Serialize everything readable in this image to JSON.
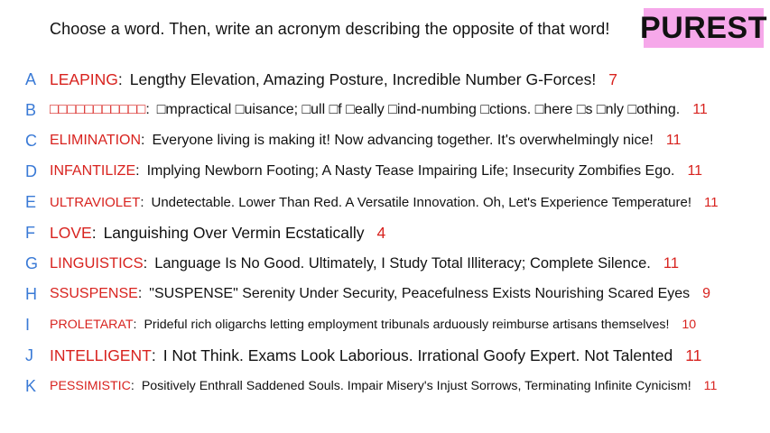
{
  "prompt": "Choose a word. Then, write an acronym describing the opposite of that word!",
  "badge": "PUREST",
  "rows": [
    {
      "letter": "A",
      "word": "LEAPING",
      "acronym": "Lengthy Elevation, Amazing Posture, Incredible Number G-Forces!",
      "count": "7"
    },
    {
      "letter": "B",
      "word": "□□□□□□□□□□□",
      "acronym": "□mpractical □uisance; □ull □f □eally □ind-numbing □ctions. □here □s □nly □othing.",
      "count": "11"
    },
    {
      "letter": "C",
      "word": "ELIMINATION",
      "acronym": "Everyone living is making it! Now advancing together. It's overwhelmingly nice!",
      "count": "11"
    },
    {
      "letter": "D",
      "word": "INFANTILIZE",
      "acronym": "Implying Newborn Footing; A Nasty Tease Impairing Life; Insecurity Zombifies Ego.",
      "count": "11"
    },
    {
      "letter": "E",
      "word": "ULTRAVIOLET",
      "acronym": "Undetectable. Lower Than Red. A Versatile Innovation. Oh, Let's Experience Temperature!",
      "count": "11"
    },
    {
      "letter": "F",
      "word": "LOVE",
      "acronym": "Languishing Over Vermin Ecstatically",
      "count": "4"
    },
    {
      "letter": "G",
      "word": "LINGUISTICS",
      "acronym": "Language Is No Good. Ultimately, I Study Total Illiteracy; Complete Silence.",
      "count": "11"
    },
    {
      "letter": "H",
      "word": "SSUSPENSE",
      "acronym": "\"SUSPENSE\" Serenity Under Security, Peacefulness Exists Nourishing Scared Eyes",
      "count": "9"
    },
    {
      "letter": "I",
      "word": "PROLETARAT",
      "acronym": "Prideful rich oligarchs letting employment tribunals arduously reimburse artisans themselves!",
      "count": "10"
    },
    {
      "letter": "J",
      "word": "INTELLIGENT",
      "acronym": "I Not Think. Exams Look Laborious. Irrational Goofy Expert. Not Talented",
      "count": "11"
    },
    {
      "letter": "K",
      "word": "PESSIMISTIC",
      "acronym": "Positively Enthrall Saddened Souls. Impair Misery's Injust Sorrows, Terminating Infinite Cynicism!",
      "count": "11"
    }
  ]
}
